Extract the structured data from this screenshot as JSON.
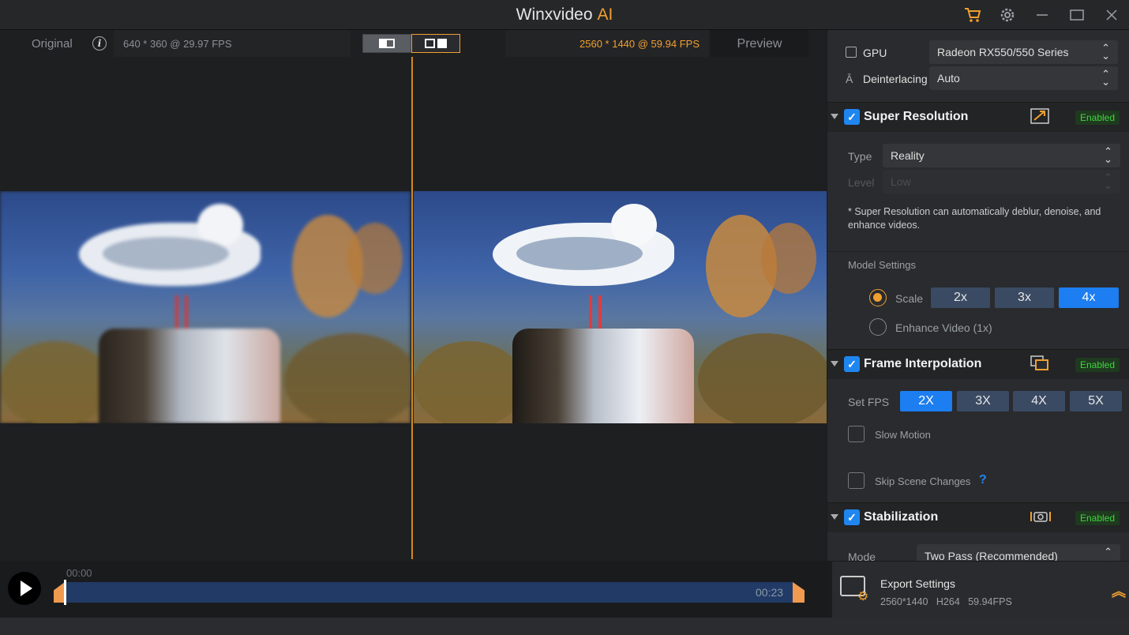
{
  "app": {
    "title": "Winxvideo",
    "title_suffix": "AI"
  },
  "titlebar": {
    "cart_icon": "cart-icon",
    "settings_icon": "gear-icon",
    "minimize": "—",
    "maximize": "☐",
    "close": "✕"
  },
  "viewer": {
    "original_label": "Original",
    "source_info": "640 * 360 @ 29.97 FPS",
    "output_info": "2560 * 1440 @ 59.94 FPS",
    "preview_label": "Preview"
  },
  "timeline": {
    "start": "00:00",
    "end": "00:23",
    "position": 0.0
  },
  "panel": {
    "gpu_label": "GPU",
    "gpu_value": "Radeon RX550/550 Series",
    "deinterlacing_label": "Deinterlacing",
    "deinterlacing_value": "Auto",
    "super_resolution": {
      "title": "Super Resolution",
      "status": "Enabled",
      "type_label": "Type",
      "type_value": "Reality",
      "level_label": "Level",
      "level_value": "Low",
      "note": "* Super Resolution can automatically deblur, denoise, and enhance videos.",
      "model_settings_label": "Model Settings",
      "scale_label": "Scale",
      "scale_options": [
        "2x",
        "3x",
        "4x"
      ],
      "scale_selected": "4x",
      "enhance_label": "Enhance Video (1x)"
    },
    "frame_interpolation": {
      "title": "Frame Interpolation",
      "status": "Enabled",
      "fps_label": "Set FPS",
      "fps_options": [
        "2X",
        "3X",
        "4X",
        "5X"
      ],
      "fps_selected": "2X",
      "slow_motion_label": "Slow Motion",
      "skip_scene_label": "Skip Scene Changes"
    },
    "stabilization": {
      "title": "Stabilization",
      "status": "Enabled",
      "mode_label": "Mode",
      "mode_value": "Two Pass (Recommended)"
    }
  },
  "export": {
    "title": "Export Settings",
    "details": "2560*1440   H264   59.94FPS"
  },
  "colors": {
    "accent": "#f0a030",
    "primary_blue": "#1c7ef0",
    "enabled_green": "#3fd63f"
  }
}
